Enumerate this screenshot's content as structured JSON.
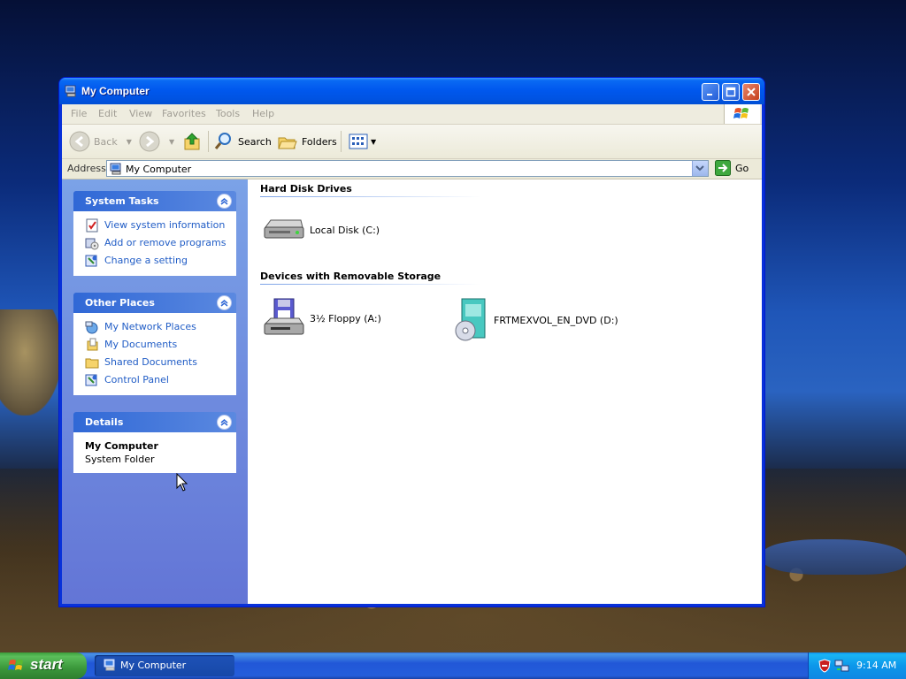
{
  "window": {
    "title": "My Computer"
  },
  "menu": [
    "File",
    "Edit",
    "View",
    "Favorites",
    "Tools",
    "Help"
  ],
  "toolbar": {
    "back": "Back",
    "search": "Search",
    "folders": "Folders"
  },
  "address": {
    "label": "Address",
    "value": "My Computer",
    "go": "Go"
  },
  "task_pane": {
    "system_tasks": {
      "title": "System Tasks",
      "items": [
        "View system information",
        "Add or remove programs",
        "Change a setting"
      ]
    },
    "other_places": {
      "title": "Other Places",
      "items": [
        "My Network Places",
        "My Documents",
        "Shared Documents",
        "Control Panel"
      ]
    },
    "details": {
      "title": "Details",
      "name": "My Computer",
      "type": "System Folder"
    }
  },
  "groups": {
    "hard_disks": {
      "title": "Hard Disk Drives",
      "items": [
        "Local Disk (C:)"
      ]
    },
    "removable": {
      "title": "Devices with Removable Storage",
      "items": [
        "3½ Floppy (A:)",
        "FRTMEXVOL_EN_DVD (D:)"
      ]
    }
  },
  "taskbar": {
    "start": "start",
    "task_button": "My Computer",
    "clock": "9:14 AM"
  },
  "colors": {
    "titlebar": "#0058ee",
    "task_link": "#215dc6",
    "start_green": "#3a973a"
  }
}
